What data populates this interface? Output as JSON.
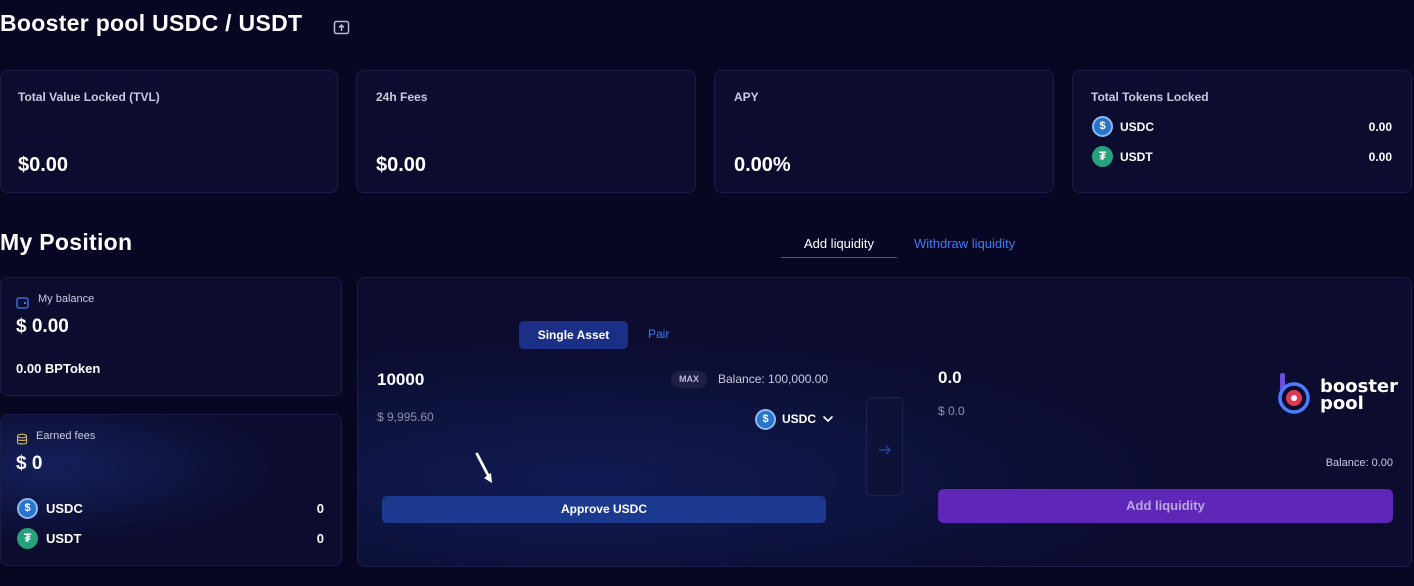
{
  "header": {
    "title": "Booster pool USDC / USDT",
    "share_icon": "share-icon"
  },
  "stats": {
    "tvl": {
      "label": "Total Value Locked (TVL)",
      "value": "$0.00"
    },
    "fees": {
      "label": "24h Fees",
      "value": "$0.00"
    },
    "apy": {
      "label": "APY",
      "value": "0.00%"
    },
    "tokens": {
      "label": "Total Tokens Locked",
      "items": [
        {
          "name": "USDC",
          "value": "0.00",
          "icon": "usdc-icon"
        },
        {
          "name": "USDT",
          "value": "0.00",
          "icon": "usdt-icon"
        }
      ]
    }
  },
  "position": {
    "title": "My Position",
    "balance": {
      "label": "My balance",
      "value": "$ 0.00",
      "bptoken": "0.00 BPToken"
    },
    "earned": {
      "label": "Earned fees",
      "value": "$ 0",
      "items": [
        {
          "name": "USDC",
          "value": "0"
        },
        {
          "name": "USDT",
          "value": "0"
        }
      ]
    }
  },
  "tabs": {
    "add": "Add liquidity",
    "withdraw": "Withdraw liquidity",
    "active": "add"
  },
  "liquidity": {
    "mode_single": "Single Asset",
    "mode_pair": "Pair",
    "input_amount": "10000",
    "input_usd": "$ 9,995.60",
    "max_label": "MAX",
    "balance_label": "Balance: 100,000.00",
    "token": "USDC",
    "approve_label": "Approve USDC",
    "output_amount": "0.0",
    "output_usd": "$ 0.0",
    "output_balance": "Balance: 0.00",
    "add_label": "Add liquidity",
    "brand_line1": "booster",
    "brand_line2": "pool"
  },
  "colors": {
    "background": "#070724",
    "card": "#0b0c2e",
    "accent_blue": "#2f6bff",
    "approve_bg": "#1b3a8f",
    "add_bg": "#5e27b7",
    "usdc": "#2775ca",
    "usdt": "#26a17b"
  }
}
